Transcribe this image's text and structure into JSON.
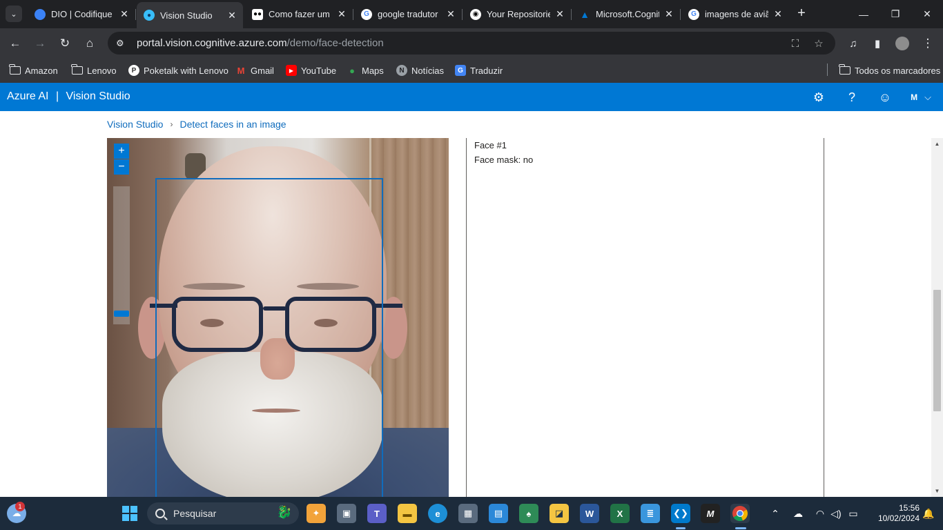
{
  "browser": {
    "tabs": [
      {
        "title": "DIO | Codifique o",
        "favicon": "dio-icon",
        "fav_color": "#3b82f6"
      },
      {
        "title": "Vision Studio",
        "favicon": "vision-studio-icon",
        "fav_color": "#38bdf8",
        "active": true
      },
      {
        "title": "Como fazer um l",
        "favicon": "medium-icon",
        "fav_color": "#ffffff"
      },
      {
        "title": "google tradutor",
        "favicon": "google-icon",
        "fav_color": "#ffffff"
      },
      {
        "title": "Your Repositorie",
        "favicon": "github-icon",
        "fav_color": "#ffffff"
      },
      {
        "title": "Microsoft.Cognit",
        "favicon": "azure-icon",
        "fav_color": "#0078d4"
      },
      {
        "title": "imagens de aviã",
        "favicon": "google-icon",
        "fav_color": "#ffffff"
      }
    ],
    "url_host": "portal.vision.cognitive.azure.com",
    "url_path": "/demo/face-detection",
    "bookmarks": [
      {
        "label": "Amazon",
        "icon": "folder-icon"
      },
      {
        "label": "Lenovo",
        "icon": "folder-icon"
      },
      {
        "label": "Poketalk with Lenovo",
        "icon": "poketalk-icon"
      },
      {
        "label": "Gmail",
        "icon": "gmail-icon"
      },
      {
        "label": "YouTube",
        "icon": "youtube-icon"
      },
      {
        "label": "Maps",
        "icon": "maps-icon"
      },
      {
        "label": "Notícias",
        "icon": "news-icon"
      },
      {
        "label": "Traduzir",
        "icon": "translate-icon"
      }
    ],
    "all_bookmarks_label": "Todos os marcadores"
  },
  "app": {
    "brand": "Azure AI",
    "product": "Vision Studio",
    "user_initial": "M",
    "accent": "#0078d4"
  },
  "breadcrumb": {
    "root": "Vision Studio",
    "current": "Detect faces in an image"
  },
  "image_viewer": {
    "zoom_in_label": "+",
    "zoom_out_label": "−"
  },
  "results": {
    "face_label": "Face #1",
    "face_mask": "Face mask: no"
  },
  "taskbar": {
    "search_placeholder": "Pesquisar",
    "notification_count": "1",
    "time": "15:56",
    "date": "10/02/2024"
  }
}
